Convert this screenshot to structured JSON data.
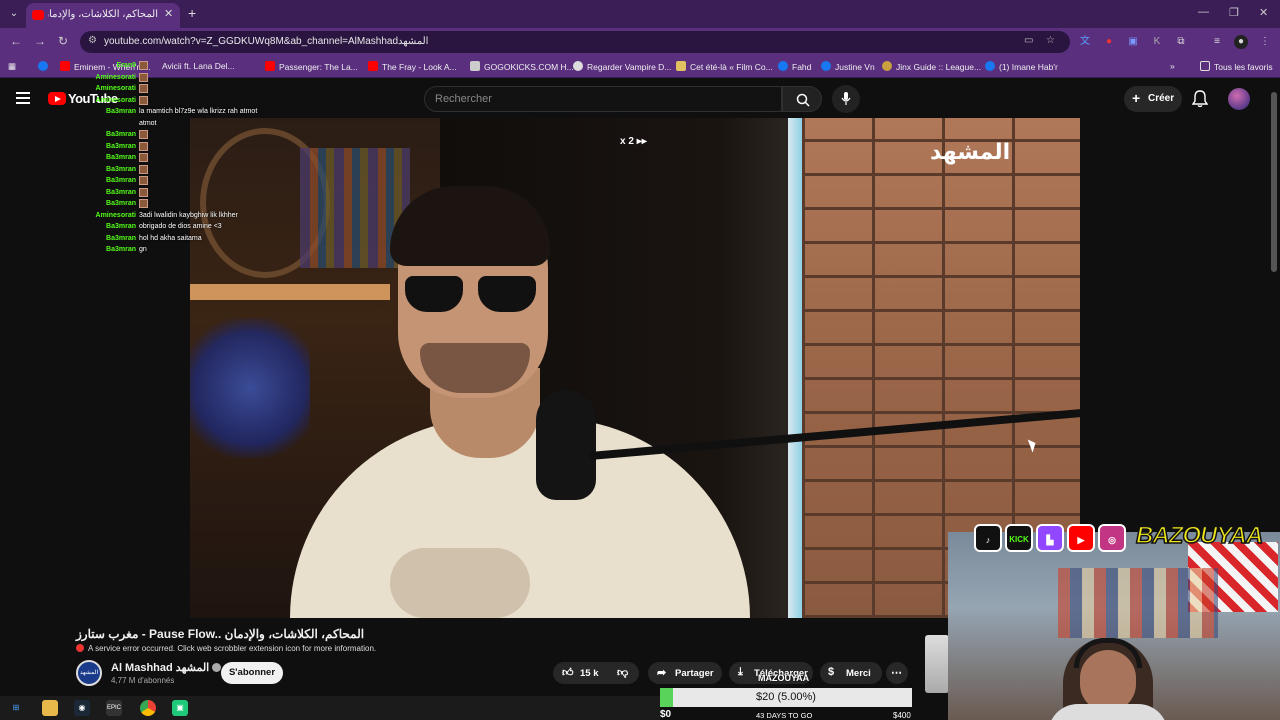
{
  "browser": {
    "tab_title": "المحاكم، الكلاشات، والإدمان -",
    "url": "youtube.com/watch?v=Z_GGDKUWq8M&ab_channel=AlMashhadالمشهد",
    "bookmarks": [
      "Eminem - When'm...",
      "Avicii ft. Lana Del...",
      "Passenger: The La...",
      "The Fray - Look A...",
      "GOGOKICKS.COM H...",
      "Regarder Vampire D...",
      "Cet été-là « Film Co...",
      "Fahd",
      "Justine Vn",
      "Jinx Guide :: League...",
      "(1) Imane Hab'r"
    ],
    "all_bookmarks": "Tous les favoris"
  },
  "youtube": {
    "logo": "YouTube",
    "search_placeholder": "Rechercher",
    "create": "Créer"
  },
  "video": {
    "speed": "x 2",
    "channel_logo": "المشهد",
    "title": "مغرب ستارز - Pause Flow.. المحاكم، الكلاشات، والإدمان",
    "error": "A service error occurred. Click web scrobbler extension icon for more information.",
    "channel_name": "Al Mashhad المشهد",
    "subscribers": "4,77 M d'abonnés",
    "subscribe": "S'abonner",
    "likes": "15 k",
    "share": "Partager",
    "download": "Télécharger",
    "thanks": "Merci"
  },
  "chat": [
    {
      "user": "Eran9",
      "msg": ""
    },
    {
      "user": "Aminesorati",
      "msg": ""
    },
    {
      "user": "Aminesorati",
      "msg": ""
    },
    {
      "user": "Aminesorati",
      "msg": ""
    },
    {
      "user": "Ba3mran",
      "msg": "la mamtich bl7z9e wla lkrizz rah atmot"
    },
    {
      "user": "",
      "msg": "atmot"
    },
    {
      "user": "Ba3mran",
      "msg": ""
    },
    {
      "user": "Ba3mran",
      "msg": ""
    },
    {
      "user": "Ba3mran",
      "msg": ""
    },
    {
      "user": "Ba3mran",
      "msg": ""
    },
    {
      "user": "Ba3mran",
      "msg": ""
    },
    {
      "user": "Ba3mran",
      "msg": ""
    },
    {
      "user": "Ba3mran",
      "msg": ""
    },
    {
      "user": "Aminesorati",
      "msg": "3adi lwalidin kaybghiw lik lkhher"
    },
    {
      "user": "Ba3mran",
      "msg": "obrigado de dios amine <3"
    },
    {
      "user": "Ba3mran",
      "msg": "hol hd akha saitama"
    },
    {
      "user": "Ba3mran",
      "msg": "gn"
    }
  ],
  "stream": {
    "streamer": "BAZOUYAA",
    "goal_name": "MAZOUYAA",
    "goal_amount": "$20 (5.00%)",
    "goal_percent": 5,
    "goal_start": "$0",
    "goal_days": "43 DAYS TO GO",
    "goal_end": "$400",
    "socials": [
      "tiktok-icon",
      "kick-icon",
      "twitch-icon",
      "youtube-icon",
      "instagram-icon"
    ],
    "kick_label": "KICK"
  }
}
